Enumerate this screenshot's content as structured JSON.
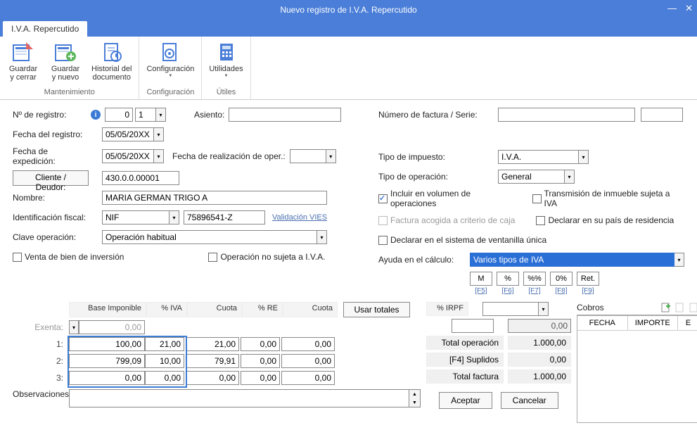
{
  "window": {
    "title": "Nuevo registro de I.V.A. Repercutido",
    "tab": "I.V.A. Repercutido"
  },
  "ribbon": {
    "groups": [
      {
        "title": "Mantenimiento",
        "items": [
          {
            "label": "Guardar\ny cerrar",
            "name": "save-close-button"
          },
          {
            "label": "Guardar\ny nuevo",
            "name": "save-new-button"
          },
          {
            "label": "Historial del\ndocumento",
            "name": "doc-history-button"
          }
        ]
      },
      {
        "title": "Configuración",
        "items": [
          {
            "label": "Configuración",
            "name": "config-button",
            "arrow": true
          }
        ]
      },
      {
        "title": "Útiles",
        "items": [
          {
            "label": "Utilidades",
            "name": "utilities-button",
            "arrow": true
          }
        ]
      }
    ]
  },
  "left": {
    "nregistro_label": "Nº de registro:",
    "nregistro_value": "0",
    "nregistro_serie": "1",
    "asiento_label": "Asiento:",
    "asiento_value": "",
    "fecha_reg_label": "Fecha del registro:",
    "fecha_reg_value": "05/05/20XX",
    "fecha_exp_label": "Fecha de expedición:",
    "fecha_exp_value": "05/05/20XX",
    "fecha_op_label": "Fecha de realización de oper.:",
    "fecha_op_value": "",
    "cliente_btn": "Cliente / Deudor:",
    "cliente_value": "430.0.0.00001",
    "nombre_label": "Nombre:",
    "nombre_value": "MARIA GERMAN TRIGO A",
    "id_fiscal_label": "Identificación fiscal:",
    "id_fiscal_type": "NIF",
    "id_fiscal_value": "75896541-Z",
    "validacion_vies": "Validación VIES",
    "clave_op_label": "Clave operación:",
    "clave_op_value": "Operación habitual",
    "venta_inversion": "Venta de bien de inversión",
    "op_no_sujeta": "Operación no sujeta a I.V.A."
  },
  "right": {
    "num_factura_label": "Número de factura / Serie:",
    "num_factura_value": "",
    "serie_value": "",
    "tipo_impuesto_label": "Tipo de impuesto:",
    "tipo_impuesto_value": "I.V.A.",
    "tipo_operacion_label": "Tipo de operación:",
    "tipo_operacion_value": "General",
    "incluir_volumen": "Incluir en volumen de operaciones",
    "transmision_inmueble": "Transmisión de inmueble sujeta a IVA",
    "factura_criterio": "Factura acogida a criterio de caja",
    "declarar_pais": "Declarar en su país de residencia",
    "declarar_ventanilla": "Declarar en el sistema de ventanilla única",
    "ayuda_calc_label": "Ayuda en el cálculo:",
    "ayuda_calc_value": "Varios tipos de IVA",
    "helper_buttons": [
      "M",
      "%",
      "%%",
      "0%",
      "Ret."
    ],
    "helper_keys": [
      "[F5]",
      "[F6]",
      "[F7]",
      "[F8]",
      "[F9]"
    ]
  },
  "grid": {
    "headers": {
      "base": "Base Imponible",
      "iva": "% IVA",
      "cuota1": "Cuota",
      "re": "% RE",
      "cuota2": "Cuota",
      "usar": "Usar totales",
      "irpf": "% IRPF"
    },
    "exenta_label": "Exenta:",
    "exenta_value": "0,00",
    "rows": [
      {
        "label": "1:",
        "base": "100,00",
        "iva": "21,00",
        "cuota1": "21,00",
        "re": "0,00",
        "cuota2": "0,00"
      },
      {
        "label": "2:",
        "base": "799,09",
        "iva": "10,00",
        "cuota1": "79,91",
        "re": "0,00",
        "cuota2": "0,00"
      },
      {
        "label": "3:",
        "base": "0,00",
        "iva": "0,00",
        "cuota1": "0,00",
        "re": "0,00",
        "cuota2": "0,00"
      }
    ],
    "irpf_value": "",
    "irpf_amount": "0,00",
    "total_op_label": "Total operación",
    "total_op_value": "1.000,00",
    "suplidos_label": "[F4] Suplidos",
    "suplidos_value": "0,00",
    "total_fac_label": "Total factura",
    "total_fac_value": "1.000,00",
    "obs_label": "Observaciones:",
    "obs_value": ""
  },
  "cobros": {
    "title": "Cobros",
    "cols": [
      "FECHA",
      "IMPORTE",
      "E"
    ]
  },
  "buttons": {
    "accept": "Aceptar",
    "cancel": "Cancelar"
  }
}
